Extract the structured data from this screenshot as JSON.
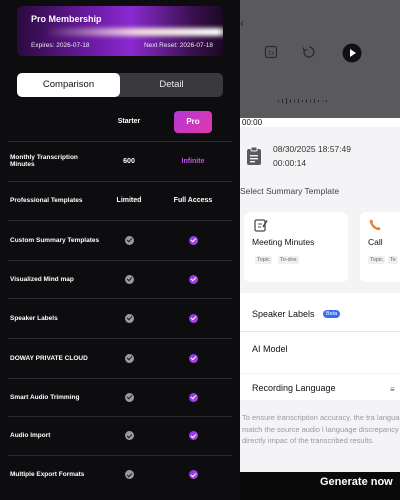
{
  "membership": {
    "title": "Pro Membership",
    "expires": "Expires:  2026-07-18",
    "next_reset": "Next Reset:  2026-07-18"
  },
  "tabs": [
    {
      "label": "Comparison",
      "active": true
    },
    {
      "label": "Detail",
      "active": false
    }
  ],
  "plans": {
    "starter": "Starter",
    "pro": "Pro"
  },
  "features": [
    {
      "name": "Monthly Transcription Minutes",
      "starter": "600",
      "pro": "Infinite"
    },
    {
      "name": "Professional Templates",
      "starter": "Limited",
      "pro": "Full Access"
    },
    {
      "name": "Custom Summary Templates",
      "starter": "check",
      "pro": "check"
    },
    {
      "name": "Visualized Mind map",
      "starter": "check",
      "pro": "check"
    },
    {
      "name": "Speaker Labels",
      "starter": "check",
      "pro": "check"
    },
    {
      "name": "DOWAY PRIVATE CLOUD",
      "starter": "check",
      "pro": "check"
    },
    {
      "name": "Smart Audio Trimming",
      "starter": "check",
      "pro": "check"
    },
    {
      "name": "Audio Import",
      "starter": "check",
      "pro": "check"
    },
    {
      "name": "Multiple Export Formats",
      "starter": "check",
      "pro": "check"
    }
  ],
  "player": {
    "position": "00:00",
    "icons": [
      "back-icon",
      "speed-icon",
      "rewind-icon",
      "play-icon"
    ]
  },
  "recording": {
    "date": "08/30/2025 18:57:49",
    "duration": "00:00:14"
  },
  "summary": {
    "section_title": "Select Summary Template",
    "templates": [
      {
        "name": "Meeting Minutes",
        "tags": [
          "Topic",
          "To-dos"
        ],
        "icon": "edit-icon",
        "color": "#4a4a55"
      },
      {
        "name": "Call",
        "tags": [
          "Topic",
          "Te"
        ],
        "icon": "phone-icon",
        "color": "#f07a2a"
      }
    ]
  },
  "options": {
    "speaker_labels": "Speaker Labels",
    "beta": "Beta",
    "ai_model": "AI Model",
    "recording_language": "Recording Language"
  },
  "note": "To ensure transcription accuracy, the tra language must match the source audio l language discrepancy will directly impac of the transcribed results.",
  "generate_label": "Generate now"
}
